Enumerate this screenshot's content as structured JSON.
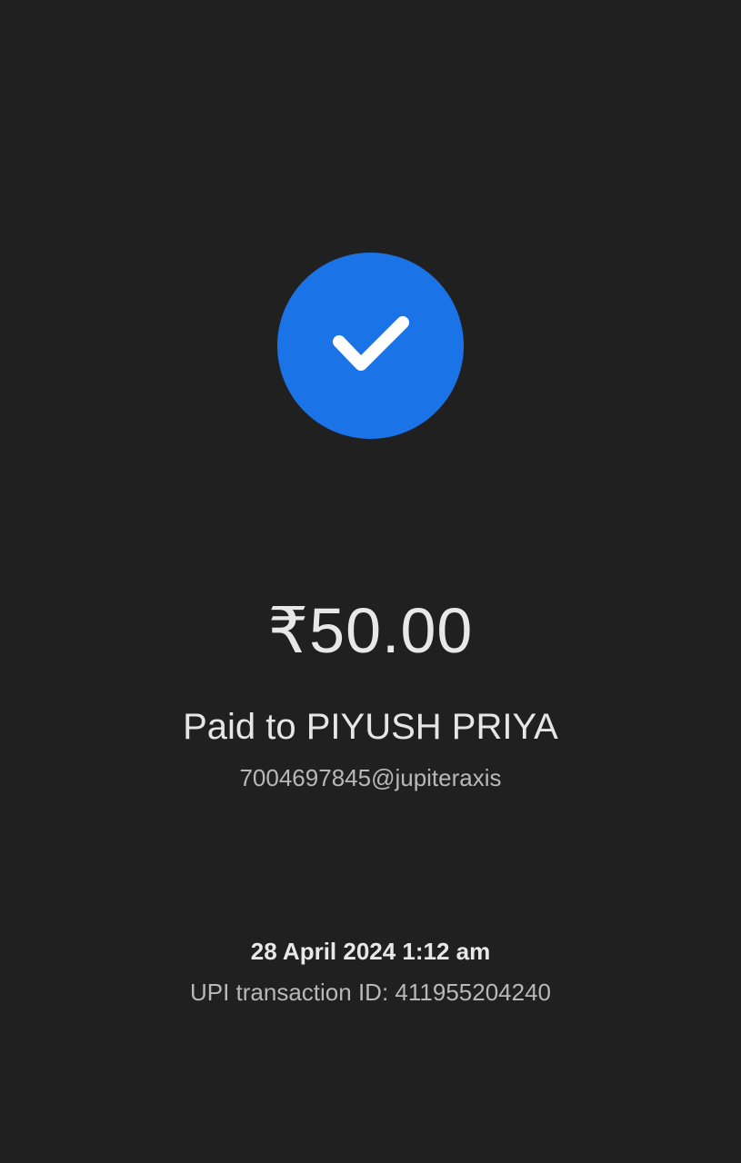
{
  "payment": {
    "status_icon": "check-icon",
    "accent_color": "#1b73e8",
    "amount": "₹50.00",
    "paid_to": "Paid to PIYUSH PRIYA",
    "upi_handle": "7004697845@jupiteraxis",
    "datetime": "28 April 2024 1:12 am",
    "transaction_id": "UPI transaction ID: 411955204240"
  }
}
